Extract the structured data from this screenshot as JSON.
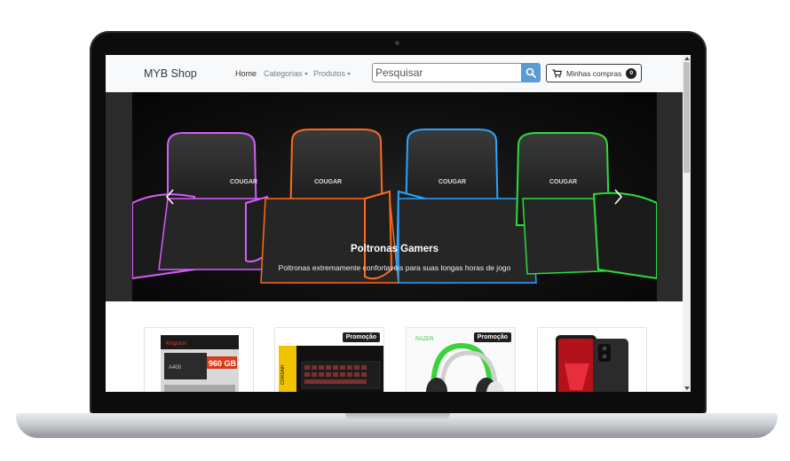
{
  "navbar": {
    "brand": "MYB Shop",
    "links": [
      {
        "label": "Home",
        "active": true
      },
      {
        "label": "Categorias",
        "dropdown": true
      },
      {
        "label": "Produtos",
        "dropdown": true
      }
    ],
    "search": {
      "placeholder": "Pesquisar",
      "icon": "search-icon"
    },
    "cart": {
      "label": "Minhas compras",
      "count": "0",
      "icon": "cart-icon"
    }
  },
  "carousel": {
    "title": "Poltronas Gamers",
    "caption": "Poltronas extremamente confortavéis para suas longas horas de jogo",
    "chair_brand": "COUGAR",
    "accent_colors": [
      "#d65cff",
      "#ff6a1a",
      "#2aa4ff",
      "#2cdd3a"
    ],
    "prev_icon": "chevron-left-icon",
    "next_icon": "chevron-right-icon"
  },
  "products": [
    {
      "kind": "ssd",
      "brand": "Kingston",
      "model": "A400",
      "capacity": "960 GB",
      "badge": ""
    },
    {
      "kind": "keyboard",
      "brand": "CORSAIR",
      "badge": "Promoção"
    },
    {
      "kind": "headset",
      "brand": "RAZER",
      "badge": "Promoção"
    },
    {
      "kind": "smartphone",
      "badge": ""
    }
  ],
  "colors": {
    "accent_button": "#5b9bd5",
    "navbar_bg": "#f8f9fa"
  }
}
